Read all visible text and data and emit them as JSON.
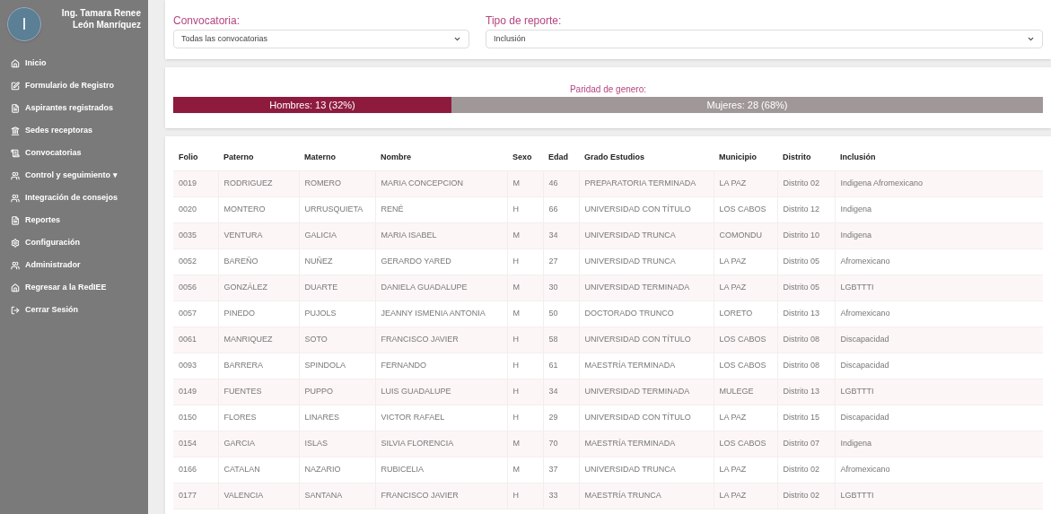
{
  "user": {
    "avatar_letter": "I",
    "name": "Ing. Tamara Renee León Manríquez"
  },
  "sidebar": {
    "items": [
      {
        "label": "Inicio"
      },
      {
        "label": "Formulario de Registro"
      },
      {
        "label": "Aspirantes registrados"
      },
      {
        "label": "Sedes receptoras"
      },
      {
        "label": "Convocatorias"
      },
      {
        "label": "Control y seguimiento ▾"
      },
      {
        "label": "Integración de consejos"
      },
      {
        "label": "Reportes"
      },
      {
        "label": "Configuración"
      },
      {
        "label": "Administrador"
      },
      {
        "label": "Regresar a la RedIEE"
      },
      {
        "label": "Cerrar Sesión"
      }
    ]
  },
  "filters": [
    {
      "label": "Convocatoria:",
      "value": "Todas las convocatorias"
    },
    {
      "label": "Tipo de reporte:",
      "value": "Inclusión"
    }
  ],
  "parity": {
    "title": "Paridad de genero:",
    "men": {
      "label": "Hombres: 13 (32%)",
      "level": 0.32
    },
    "women": {
      "label": "Mujeres: 28 (68%)"
    }
  },
  "table": {
    "columns": [
      "Folio",
      "Paterno",
      "Materno",
      "Nombre",
      "Sexo",
      "Edad",
      "Grado Estudios",
      "Municipio",
      "Distrito",
      "Inclusión"
    ],
    "rows": [
      [
        "0019",
        "RODRIGUEZ",
        "ROMERO",
        "MARIA CONCEPCION",
        "M",
        "46",
        "PREPARATORIA TERMINADA",
        "LA PAZ",
        "Distrito 02",
        "Indigena Afromexicano"
      ],
      [
        "0020",
        "MONTERO",
        "URRUSQUIETA",
        "RENÉ",
        "H",
        "66",
        "UNIVERSIDAD CON TÍTULO",
        "LOS CABOS",
        "Distrito 12",
        "Indigena"
      ],
      [
        "0035",
        "VENTURA",
        "GALICIA",
        "MARIA ISABEL",
        "M",
        "34",
        "UNIVERSIDAD TRUNCA",
        "COMONDU",
        "Distrito 10",
        "Indigena"
      ],
      [
        "0052",
        "BAREÑO",
        "NUÑEZ",
        "GERARDO YARED",
        "H",
        "27",
        "UNIVERSIDAD TRUNCA",
        "LA PAZ",
        "Distrito 05",
        "Afromexicano"
      ],
      [
        "0056",
        "GONZÁLEZ",
        "DUARTE",
        "DANIELA GUADALUPE",
        "M",
        "30",
        "UNIVERSIDAD TERMINADA",
        "LA PAZ",
        "Distrito 05",
        "LGBTTTI"
      ],
      [
        "0057",
        "PINEDO",
        "PUJOLS",
        "JEANNY ISMENIA ANTONIA",
        "M",
        "50",
        "DOCTORADO TRUNCO",
        "LORETO",
        "Distrito 13",
        "Afromexicano"
      ],
      [
        "0061",
        "MANRIQUEZ",
        "SOTO",
        "FRANCISCO JAVIER",
        "H",
        "58",
        "UNIVERSIDAD CON TÍTULO",
        "LOS CABOS",
        "Distrito 08",
        "Discapacidad"
      ],
      [
        "0093",
        "BARRERA",
        "SPINDOLA",
        "FERNANDO",
        "H",
        "61",
        "MAESTRÍA TERMINADA",
        "LOS CABOS",
        "Distrito 08",
        "Discapacidad"
      ],
      [
        "0149",
        "FUENTES",
        "PUPPO",
        "LUIS GUADALUPE",
        "H",
        "34",
        "UNIVERSIDAD TERMINADA",
        "MULEGE",
        "Distrito 13",
        "LGBTTTI"
      ],
      [
        "0150",
        "FLORES",
        "LINARES",
        "VICTOR RAFAEL",
        "H",
        "29",
        "UNIVERSIDAD CON TÍTULO",
        "LA PAZ",
        "Distrito 15",
        "Discapacidad"
      ],
      [
        "0154",
        "GARCIA",
        "ISLAS",
        "SILVIA FLORENCIA",
        "M",
        "70",
        "MAESTRÍA TERMINADA",
        "LOS CABOS",
        "Distrito 07",
        "Indigena"
      ],
      [
        "0166",
        "CATALAN",
        "NAZARIO",
        "RUBICELIA",
        "M",
        "37",
        "UNIVERSIDAD TRUNCA",
        "LA PAZ",
        "Distrito 02",
        "Afromexicano"
      ],
      [
        "0177",
        "VALENCIA",
        "SANTANA",
        "FRANCISCO JAVIER",
        "H",
        "33",
        "MAESTRÍA TRUNCA",
        "LA PAZ",
        "Distrito 02",
        "LGBTTTI"
      ]
    ]
  }
}
